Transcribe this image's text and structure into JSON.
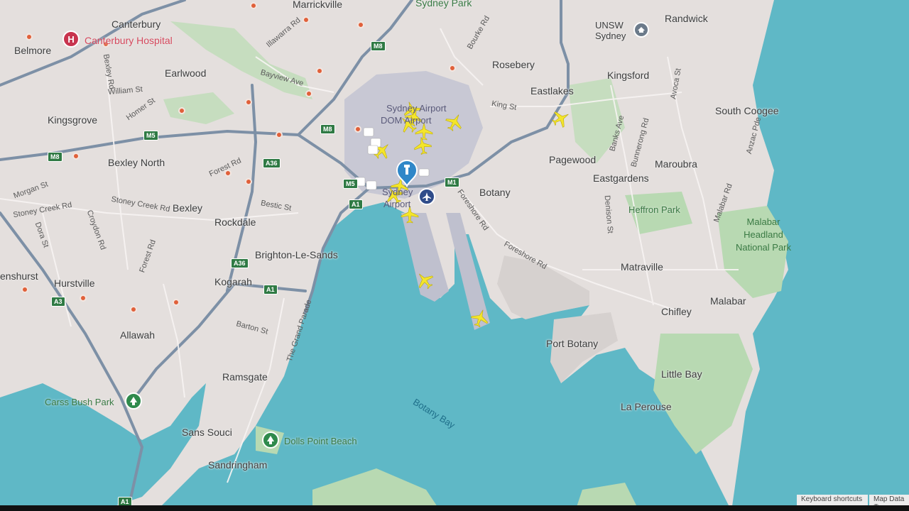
{
  "map": {
    "suburbs": [
      {
        "name": "Marrickville"
      },
      {
        "name": "Sydney Park"
      },
      {
        "name": "Randwick"
      },
      {
        "name": "Canterbury"
      },
      {
        "name": "UNSW Sydney"
      },
      {
        "name": "Belmore"
      },
      {
        "name": "Earlwood"
      },
      {
        "name": "Rosebery"
      },
      {
        "name": "Kingsford"
      },
      {
        "name": "Eastlakes"
      },
      {
        "name": "Kingsgrove"
      },
      {
        "name": "South Coogee"
      },
      {
        "name": "Bexley North"
      },
      {
        "name": "Pagewood"
      },
      {
        "name": "Maroubra"
      },
      {
        "name": "Eastgardens"
      },
      {
        "name": "Botany"
      },
      {
        "name": "Bexley"
      },
      {
        "name": "Rockdale"
      },
      {
        "name": "Brighton-Le-Sands"
      },
      {
        "name": "Hurstville"
      },
      {
        "name": "Kogarah"
      },
      {
        "name": "Matraville"
      },
      {
        "name": "Chifley"
      },
      {
        "name": "Malabar"
      },
      {
        "name": "Allawah"
      },
      {
        "name": "Port Botany"
      },
      {
        "name": "Ramsgate"
      },
      {
        "name": "Little Bay"
      },
      {
        "name": "La Perouse"
      },
      {
        "name": "Sans Souci"
      },
      {
        "name": "Sandringham"
      },
      {
        "name": "enshurst"
      }
    ],
    "hospital": "Canterbury Hospital",
    "parks": [
      "Heffron Park",
      "Carss Bush Park",
      "Dolls Point Beach"
    ],
    "park_large": [
      "Malabar",
      "Headland",
      "National Park"
    ],
    "water_label": "Botany Bay",
    "airport_labels": [
      "Sydney Airport",
      "DOM Airport",
      "Sydney",
      "Airport"
    ],
    "streets": [
      "Illawarra Rd",
      "Bourke Rd",
      "Bayview Ave",
      "William St",
      "Homer St",
      "King St",
      "Bexley Rd",
      "Forest Rd",
      "Morgan St",
      "Stoney Creek Rd",
      "Stoney Creek Rd",
      "Bestic St",
      "Croydon Rd",
      "Dora St",
      "Forest Rd",
      "Barton St",
      "The Grand Parade",
      "Foreshore Rd",
      "Foreshore Rd",
      "Banks Ave",
      "Bunnerong Rd",
      "Avoca St",
      "Denison St",
      "Malabar Rd",
      "Anzac Pde"
    ],
    "road_shields": [
      "M8",
      "M5",
      "M8",
      "A36",
      "M5",
      "M1",
      "A1",
      "A36",
      "A1",
      "A3",
      "A1"
    ],
    "aircraft_count": 16,
    "footer": {
      "keyboard": "Keyboard shortcuts",
      "map_data": "Map Data ©"
    },
    "colors": {
      "land": "#e4dfdd",
      "water": "#5fb8c6",
      "park": "#b8d9b2",
      "motorway": "#7d90a6",
      "airport": "#c8c8d4",
      "plane": "#f4e52a"
    }
  }
}
